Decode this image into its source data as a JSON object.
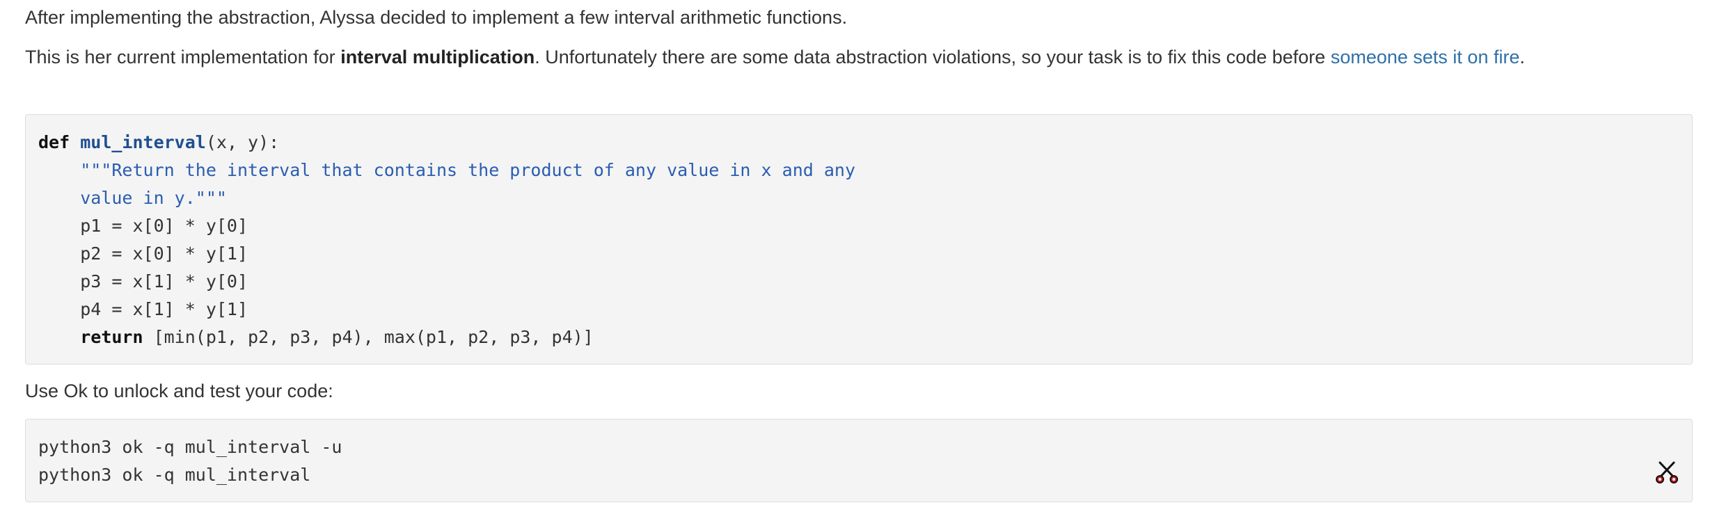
{
  "intro": {
    "line1": "After implementing the abstraction, Alyssa decided to implement a few interval arithmetic functions.",
    "line2_before": "This is her current implementation for ",
    "line2_bold": "interval multiplication",
    "line2_after": ". Unfortunately there are some data abstraction violations, so your task is to fix this code before ",
    "line2_link": "someone sets it on fire",
    "line2_end": "."
  },
  "code": {
    "line1_kw": "def",
    "line1_fn": "mul_interval",
    "line1_rest": "(x, y):",
    "docstring_line1": "    \"\"\"Return the interval that contains the product of any value in x and any",
    "docstring_line2": "    value in y.\"\"\"",
    "line_p1": "    p1 = x[0] * y[0]",
    "line_p2": "    p2 = x[0] * y[1]",
    "line_p3": "    p3 = x[1] * y[0]",
    "line_p4": "    p4 = x[1] * y[1]",
    "return_indent": "    ",
    "return_kw": "return",
    "return_rest": " [min(p1, p2, p3, p4), max(p1, p2, p3, p4)]"
  },
  "ok": {
    "instruction": "Use Ok to unlock and test your code:",
    "cmd1": "python3 ok -q mul_interval -u",
    "cmd2": "python3 ok -q mul_interval",
    "copy_icon": "scissors-icon"
  },
  "colors": {
    "link": "#2f6fa7",
    "code_bg": "#f4f4f4",
    "function_name": "#1f4f8f",
    "docstring": "#2a5db0",
    "scissors_red": "#d42020"
  }
}
